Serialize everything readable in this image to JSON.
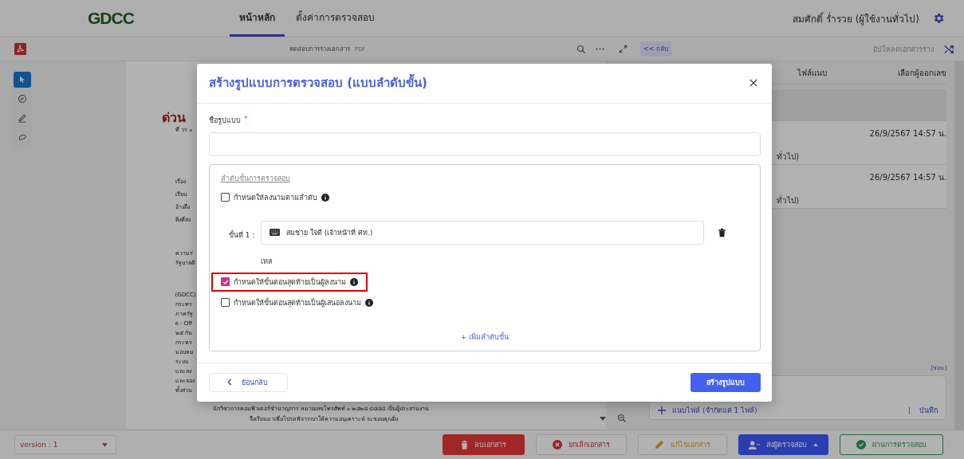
{
  "header": {
    "logo": "GDCC",
    "tabs": [
      {
        "label": "หน้าหลัก",
        "selected": true
      },
      {
        "label": "ตั้งค่าการตรวจสอบ",
        "selected": false
      }
    ],
    "user": "สมศักดิ์ ร่ำรวย (ผู้ใช้งานทั่วไป)"
  },
  "toolbar": {
    "file_name": "ทดสอบการร่างเอกสาร",
    "file_type": "PDF",
    "back": "<< กลับ",
    "upload": "อัปโหลดเอกสารร่าง"
  },
  "tools": [
    {
      "kind": "pointer",
      "selected": true
    },
    {
      "kind": "comment",
      "selected": false
    },
    {
      "kind": "pen",
      "selected": false
    },
    {
      "kind": "lasso",
      "selected": false
    }
  ],
  "document": {
    "urgent": "ด่วน",
    "ref": "ที่ วร ๐",
    "blocks": [
      [
        "เรื่อง",
        "เรียน",
        "อ้างถึง",
        "สิ่งที่ส่ง"
      ],
      [
        "ความร่",
        "รัฐบาลดิ"
      ],
      [
        "(GDCC)",
        "กระทร",
        "ภาครัฐ",
        "e - Off",
        "๒๕ กัน",
        "กระทร",
        "มอบหม",
        "ระบบ",
        "และลง",
        "และจอง",
        "ทั้งส่วน"
      ]
    ],
    "closing": [
      "นักวิชาการคอมพิวเตอร์ชำนาญการ หมายเลขโทรศัพท์ ๐ ๒๘๒๘ ๔๘๘๘ เป็นผู้ประสานงาน",
      "จึงเรียนมาเพื่อโปรดพิจารณาให้ความอนุเคราะห์ จะขอบคุณยิ่ง"
    ]
  },
  "side_panel": {
    "columns": [
      "ไฟล์แนบ",
      "เลือกผู้ออกเลข"
    ],
    "rows": [
      {
        "selected": true
      },
      {
        "selected": false,
        "role": "ทั่วไป)",
        "date": "26/9/2567 14:57 น."
      },
      {
        "selected": false,
        "role": "ทั่วไป)",
        "date": "26/9/2567 14:57 น."
      }
    ],
    "hide": "[ซ่อน]",
    "attach": "แนบไฟล์ (จำกัดแค่ 1 ไฟล์)",
    "save": "บันทึก"
  },
  "footer": {
    "version": "version : 1",
    "buttons": [
      {
        "kind": "delete",
        "label": "ลบเอกสาร"
      },
      {
        "kind": "cancel",
        "label": "ยกเลิกเอกสาร"
      },
      {
        "kind": "edit",
        "label": "แก้ไขเอกสาร"
      },
      {
        "kind": "send",
        "label": "ส่งผู้ตรวจสอบ"
      },
      {
        "kind": "approve",
        "label": "ผ่านการตรวจสอบ"
      }
    ]
  },
  "modal": {
    "title": "สร้างรูปแบบการตรวจสอบ (แบบลำดับขั้น)",
    "name_label": "ชื่อรูปแบบ",
    "required_mark": "*",
    "section_title": "ลำดับขั้นการตรวจสอบ",
    "sequential": {
      "label": "กำหนดให้ลงนามตามลำดับ",
      "checked": false
    },
    "steps": [
      {
        "label": "ขั้นที่ 1 :",
        "value": "สมชาย ใจดี (เจ้าหน้าที่ ศท.)",
        "note": "เทส"
      }
    ],
    "options": [
      {
        "label": "กำหนดให้ขั้นตอนสุดท้ายเป็นผู้ลงนาม",
        "checked": true,
        "highlighted": true
      },
      {
        "label": "กำหนดให้ขั้นตอนสุดท้ายเป็นผู้เสนอลงนาม",
        "checked": false,
        "highlighted": false
      }
    ],
    "add_step": "+ เพิ่มลำดับขั้น",
    "back": "ย้อนกลับ",
    "create": "สร้างรูปแบบ"
  }
}
